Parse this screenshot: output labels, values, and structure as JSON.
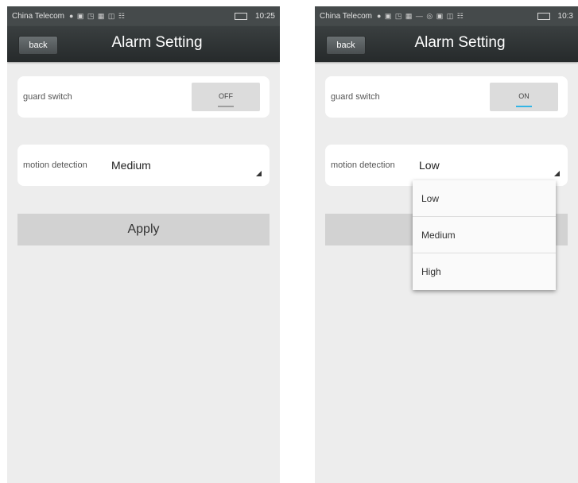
{
  "screens": [
    {
      "status_bar": {
        "carrier": "China Telecom",
        "icons": "● ▣ ◳ ▦ ◫ ☷",
        "time": "10:25"
      },
      "nav": {
        "back_label": "back",
        "title": "Alarm Setting"
      },
      "guard": {
        "label": "guard switch",
        "toggle_label": "OFF",
        "indicator_color": "#9e9e9e"
      },
      "motion": {
        "label": "motion detection",
        "value": "Medium"
      },
      "apply_label": "Apply"
    },
    {
      "status_bar": {
        "carrier": "China Telecom",
        "icons": "● ▣ ◳ ▦ — ◎ ▣ ◫ ☷",
        "time": "10:3"
      },
      "nav": {
        "back_label": "back",
        "title": "Alarm Setting"
      },
      "guard": {
        "label": "guard switch",
        "toggle_label": "ON",
        "indicator_color": "#33b5e5"
      },
      "motion": {
        "label": "motion detection",
        "value": "Low"
      },
      "dropdown_options": [
        "Low",
        "Medium",
        "High"
      ]
    }
  ]
}
